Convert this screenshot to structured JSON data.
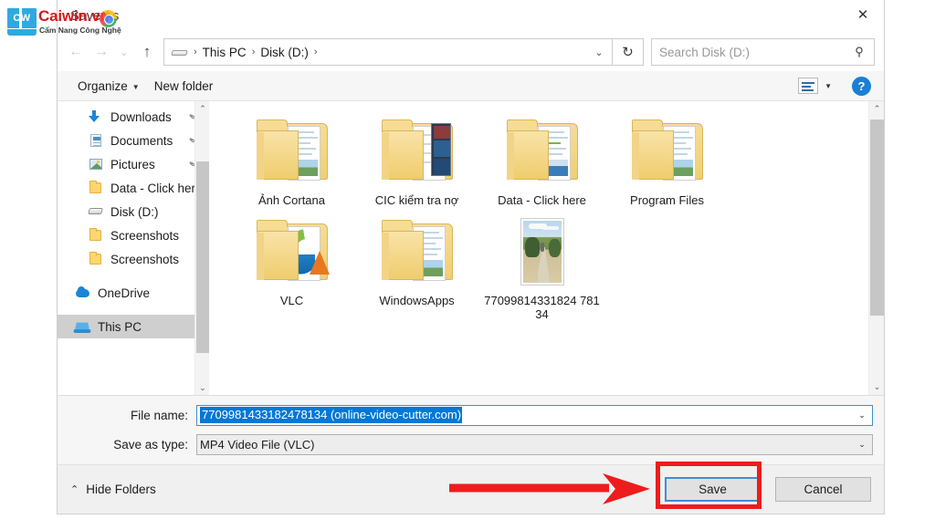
{
  "watermark": {
    "logo_text": "CW",
    "brand": "Caiwin.vn",
    "tagline": "Cẩm Nang Công Nghệ",
    "brand_color": "#d41b1b"
  },
  "dialog": {
    "title": "Save As",
    "close_label": "✕"
  },
  "nav": {
    "back_icon": "←",
    "forward_icon": "→",
    "recent_icon": "⌄",
    "up_icon": "↑",
    "refresh_icon": "↻"
  },
  "address": {
    "drive_icon": "drive-icon",
    "crumbs": [
      {
        "label": "This PC"
      },
      {
        "label": "Disk (D:)"
      }
    ],
    "separator": "›",
    "dropdown_icon": "⌄"
  },
  "search": {
    "placeholder": "Search Disk (D:)",
    "icon": "⚲"
  },
  "toolbar": {
    "organize_label": "Organize",
    "organize_caret": "▼",
    "new_folder_label": "New folder",
    "view_caret": "▼",
    "help_label": "?"
  },
  "sidebar": {
    "items": [
      {
        "label": "Downloads",
        "icon": "download-icon",
        "pinned": true,
        "selected": false
      },
      {
        "label": "Documents",
        "icon": "document-icon",
        "pinned": true,
        "selected": false
      },
      {
        "label": "Pictures",
        "icon": "pictures-icon",
        "pinned": true,
        "selected": false
      },
      {
        "label": "Data - Click here",
        "icon": "folder-icon",
        "pinned": false,
        "selected": false
      },
      {
        "label": "Disk (D:)",
        "icon": "drive-icon",
        "pinned": false,
        "selected": false
      },
      {
        "label": "Screenshots",
        "icon": "folder-icon",
        "pinned": false,
        "selected": false
      },
      {
        "label": "Screenshots",
        "icon": "folder-icon",
        "pinned": false,
        "selected": false
      },
      {
        "label": "OneDrive",
        "icon": "onedrive-icon",
        "pinned": false,
        "selected": false
      },
      {
        "label": "This PC",
        "icon": "this-pc-icon",
        "pinned": false,
        "selected": true
      }
    ],
    "pin_glyph": "📌",
    "scroll_up": "⌃",
    "scroll_down": "⌄"
  },
  "files": {
    "items": [
      {
        "label": "Ảnh Cortana",
        "type": "folder-documents"
      },
      {
        "label": "CIC kiểm tra nợ",
        "type": "folder-cic"
      },
      {
        "label": "Data - Click here",
        "type": "folder-documents"
      },
      {
        "label": "Program Files",
        "type": "folder-documents"
      },
      {
        "label": "VLC",
        "type": "folder-vlc"
      },
      {
        "label": "WindowsApps",
        "type": "folder-documents"
      },
      {
        "label": "77099814331824 78134",
        "type": "image-thumbnail"
      }
    ],
    "scroll_up": "⌃",
    "scroll_down": "⌄"
  },
  "form": {
    "filename_label": "File name:",
    "filename_value": "7709981433182478134 (online-video-cutter.com)",
    "savetype_label": "Save as type:",
    "savetype_value": "MP4 Video File (VLC)",
    "dropdown_icon": "⌄",
    "selection_color": "#0078d7"
  },
  "footer": {
    "hide_folders_label": "Hide Folders",
    "hide_folders_chevron": "⌃",
    "save_label": "Save",
    "cancel_label": "Cancel"
  },
  "annotations": {
    "highlight_color": "#ee1c1c",
    "arrow_target": "save-button"
  }
}
